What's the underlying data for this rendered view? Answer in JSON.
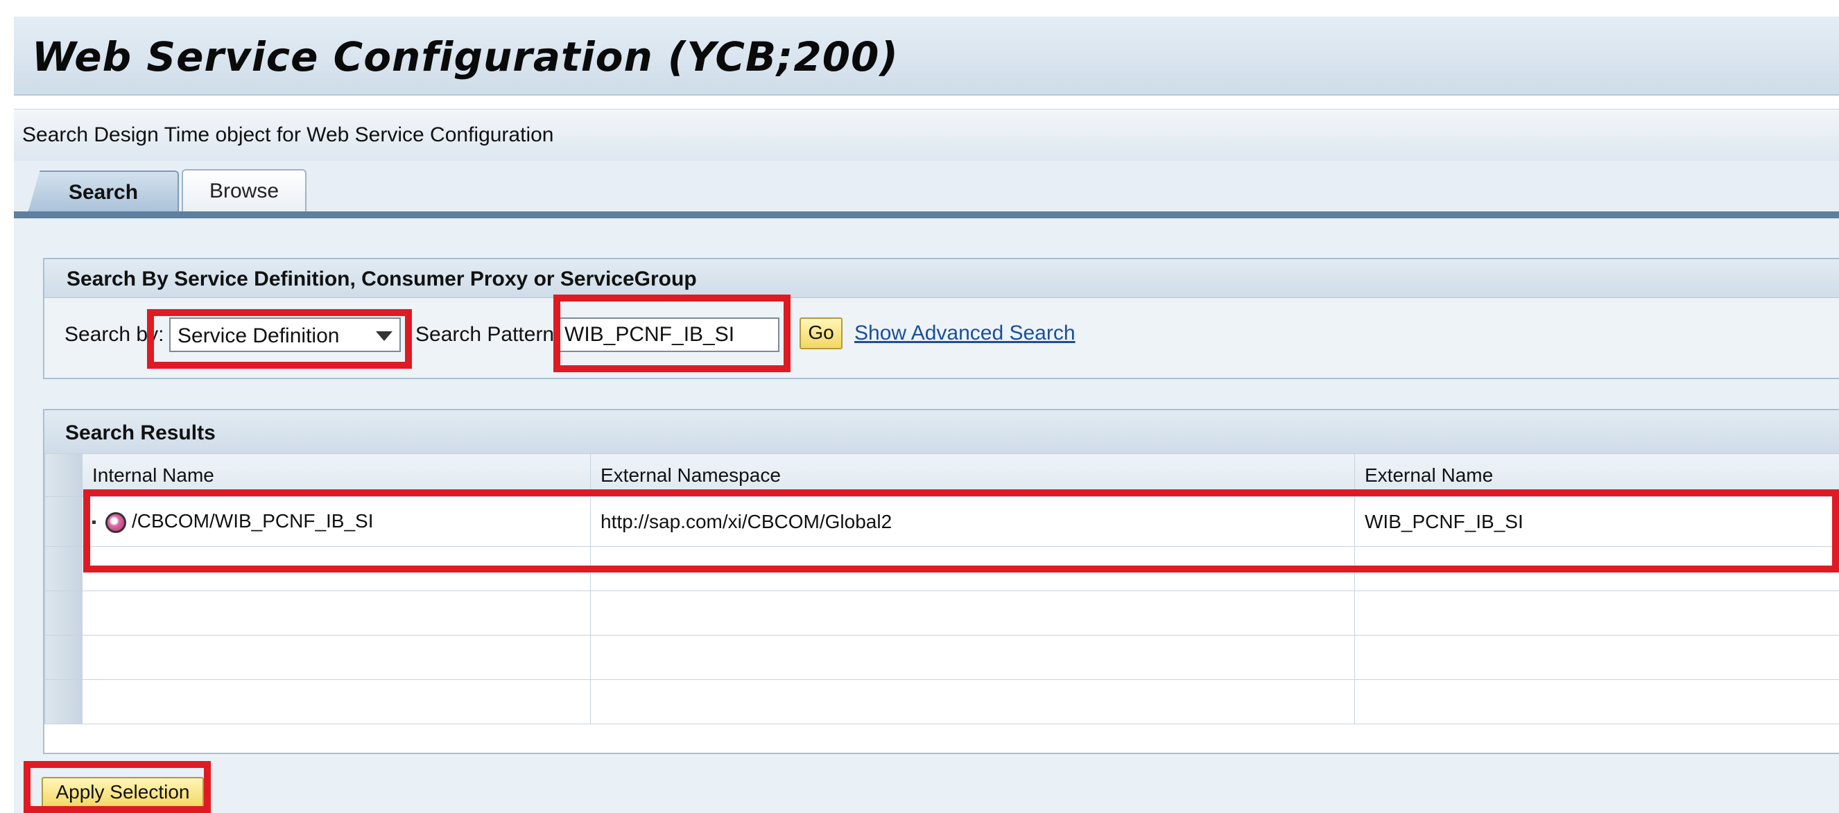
{
  "header": {
    "title": "Web Service Configuration (YCB;200)"
  },
  "subheader": {
    "text": "Search Design Time object for Web Service Configuration"
  },
  "tabs": [
    {
      "label": "Search",
      "active": true
    },
    {
      "label": "Browse",
      "active": false
    }
  ],
  "search_panel": {
    "title": "Search By Service Definition, Consumer Proxy or ServiceGroup",
    "search_by_label": "Search by:",
    "search_by_value": "Service Definition",
    "pattern_label": "Search Pattern:",
    "pattern_value": "WIB_PCNF_IB_SI",
    "go_label": "Go",
    "advanced_link": "Show Advanced Search"
  },
  "results": {
    "title": "Search Results",
    "columns": [
      "Internal Name",
      "External Namespace",
      "External Name"
    ],
    "rows": [
      [
        "/CBCOM/WIB_PCNF_IB_SI",
        "http://sap.com/xi/CBCOM/Global2",
        "WIB_PCNF_IB_SI"
      ]
    ]
  },
  "actions": {
    "apply_label": "Apply Selection"
  },
  "colors": {
    "highlight": "#e01a22",
    "button": "#f3d763",
    "link": "#1b4f9b"
  }
}
